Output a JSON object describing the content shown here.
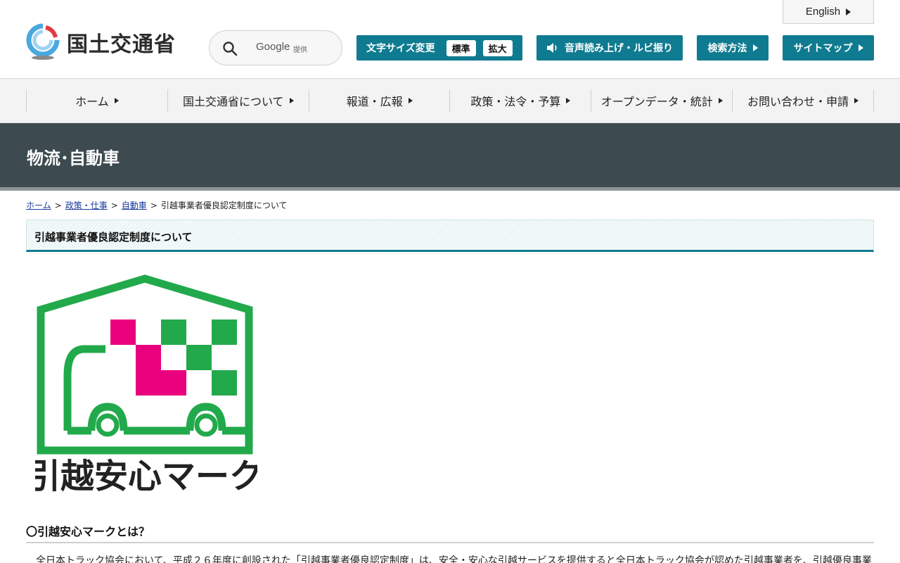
{
  "header": {
    "logo_text": "国土交通省",
    "search": {
      "brand": "Google",
      "sub": "提供"
    },
    "english_label": "English",
    "font_size_label": "文字サイズ変更",
    "font_size_options": [
      "標準",
      "拡大"
    ],
    "speech_label": "音声読み上げ・ルビ振り",
    "search_method_label": "検索方法",
    "sitemap_label": "サイトマップ",
    "colors": {
      "accent": "#0f7b90",
      "band": "#3d4a50"
    }
  },
  "gnav": [
    {
      "label": "ホーム"
    },
    {
      "label": "国土交通省について"
    },
    {
      "label": "報道・広報"
    },
    {
      "label": "政策・法令・予算"
    },
    {
      "label": "オープンデータ・統計"
    },
    {
      "label": "お問い合わせ・申請"
    }
  ],
  "category": {
    "title": "物流･自動車"
  },
  "breadcrumb": {
    "items": [
      "ホーム",
      "政策・仕事",
      "自動車"
    ],
    "current": "引越事業者優良認定制度について",
    "sep": ">"
  },
  "page": {
    "title": "引越事業者優良認定制度について",
    "mark": {
      "text": "引越安心マーク",
      "colors": {
        "green": "#22a94b",
        "magenta": "#e8007d",
        "text": "#222222"
      }
    },
    "section_heading": "〇引越安心マークとは？",
    "body": "全日本トラック協会において、平成２６年度に創設された「引越事業者優良認定制度」は、安全・安心な引越サービスを提供すると全日本トラック協会が認めた引越事業者を、引越優良事業"
  }
}
